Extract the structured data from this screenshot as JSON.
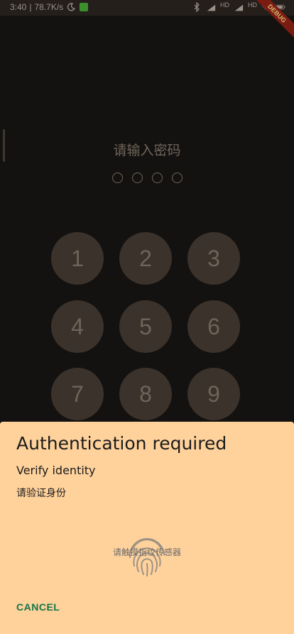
{
  "status_bar": {
    "time": "3:40",
    "speed": "78.7K/s",
    "battery": "",
    "signal_label_1": "HD",
    "signal_label_2": "HD"
  },
  "debug_banner": "DEBUG",
  "lock_screen": {
    "prompt": "请输入密码",
    "pin_length": 4,
    "keys": [
      "1",
      "2",
      "3",
      "4",
      "5",
      "6",
      "7",
      "8",
      "9"
    ]
  },
  "auth_sheet": {
    "title": "Authentication required",
    "subtitle": "Verify identity",
    "description": "请验证身份",
    "fingerprint_hint": "请触摸指纹传感器",
    "cancel_label": "CANCEL",
    "accent_color": "#137547"
  },
  "icons": [
    "moon-icon",
    "wechat-icon",
    "alarm-icon",
    "bluetooth-icon",
    "signal-icon",
    "wifi-icon",
    "battery-icon",
    "fingerprint-icon"
  ]
}
